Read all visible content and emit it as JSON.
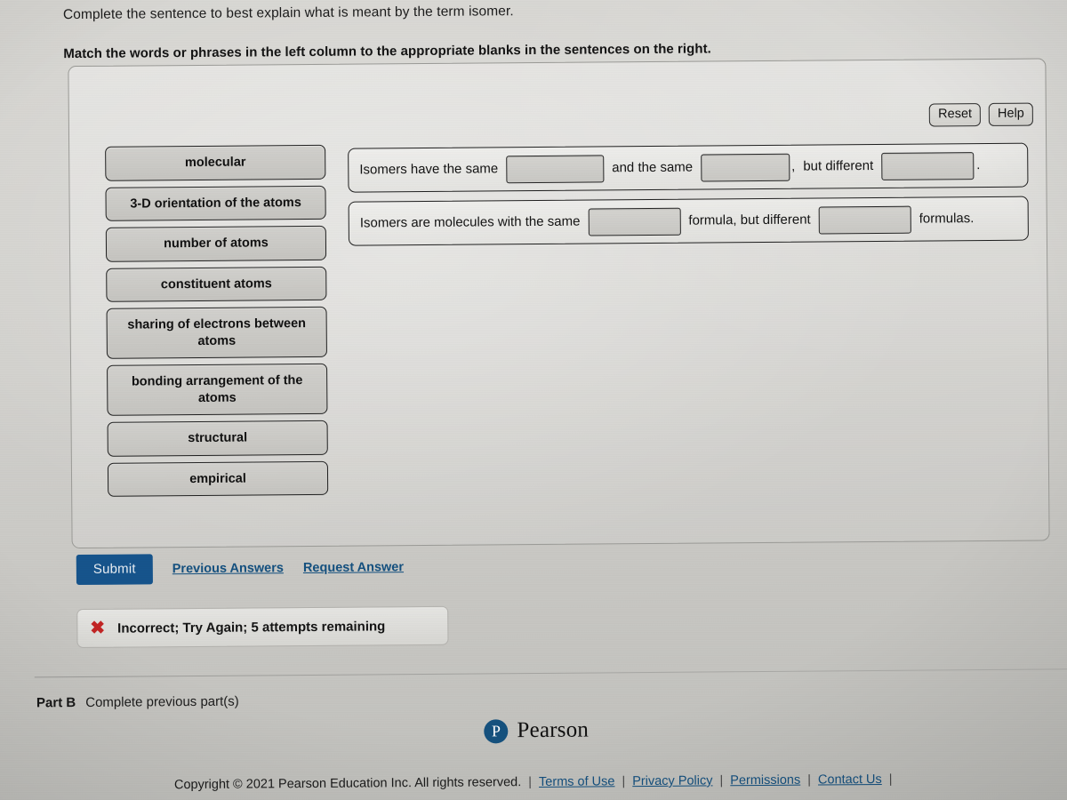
{
  "question": {
    "prompt": "Complete the sentence to best explain what is meant by the term isomer.",
    "instruction": "Match the words or phrases in the left column to the appropriate blanks in the sentences on the right."
  },
  "panel": {
    "reset_label": "Reset",
    "help_label": "Help"
  },
  "tiles": [
    {
      "label": "molecular"
    },
    {
      "label": "3-D orientation of the atoms"
    },
    {
      "label": "number of atoms"
    },
    {
      "label": "constituent atoms"
    },
    {
      "label": "sharing of electrons between atoms"
    },
    {
      "label": "bonding arrangement of the atoms"
    },
    {
      "label": "structural"
    },
    {
      "label": "empirical"
    }
  ],
  "sentences": [
    {
      "lead": "Isomers have the same",
      "mid": "and the same",
      "punct": ",",
      "tail": "but different",
      "end": ".",
      "blank1": "",
      "blank2": "",
      "blank3": ""
    },
    {
      "lead": "Isomers are molecules with the same",
      "mid": "formula, but different",
      "trail": "formulas.",
      "blank1": "",
      "blank2": ""
    }
  ],
  "actions": {
    "submit_label": "Submit",
    "previous_answers_label": "Previous Answers",
    "request_answer_label": "Request Answer"
  },
  "feedback": {
    "icon": "x-mark-icon",
    "text": "Incorrect; Try Again; 5 attempts remaining"
  },
  "part": {
    "label": "Part B",
    "status": "Complete previous part(s)"
  },
  "footer": {
    "brand_initial": "P",
    "brand_name": "Pearson",
    "copyright": "Copyright © 2021 Pearson Education Inc. All rights reserved.",
    "sep": "|",
    "links": [
      "Terms of Use",
      "Privacy Policy",
      "Permissions",
      "Contact Us"
    ]
  },
  "colors": {
    "submit_blue": "#16548c",
    "link_blue": "#14507f",
    "error_red": "#c22424",
    "tile_gray": "#c9c8c4",
    "page_gray": "#d2d1cd"
  }
}
